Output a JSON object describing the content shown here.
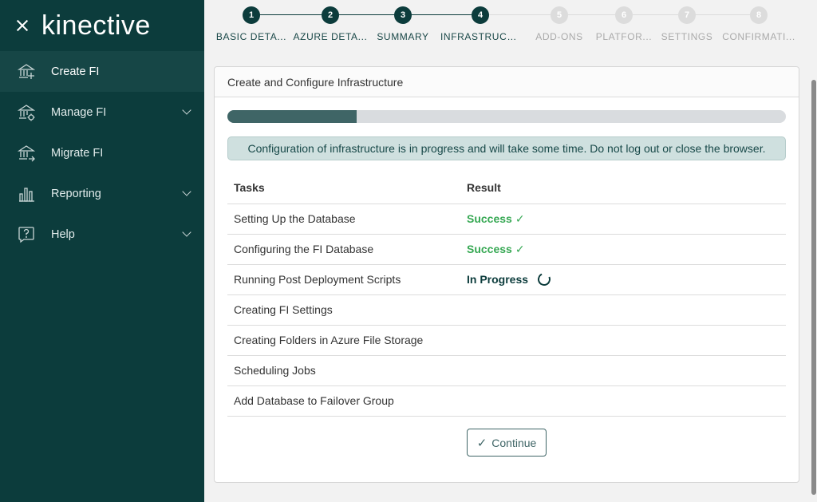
{
  "app": {
    "logo_text": "kinective"
  },
  "sidebar": {
    "items": [
      {
        "label": "Create FI",
        "icon": "bank-plus-icon",
        "active": true,
        "expandable": false
      },
      {
        "label": "Manage FI",
        "icon": "bank-gear-icon",
        "active": false,
        "expandable": true
      },
      {
        "label": "Migrate FI",
        "icon": "bank-arrow-icon",
        "active": false,
        "expandable": false
      },
      {
        "label": "Reporting",
        "icon": "bar-chart-icon",
        "active": false,
        "expandable": true
      },
      {
        "label": "Help",
        "icon": "help-bubble-icon",
        "active": false,
        "expandable": true
      }
    ]
  },
  "stepper": {
    "steps": [
      {
        "number": "1",
        "label": "BASIC DETA...",
        "state": "done"
      },
      {
        "number": "2",
        "label": "AZURE DETA...",
        "state": "done"
      },
      {
        "number": "3",
        "label": "SUMMARY",
        "state": "done"
      },
      {
        "number": "4",
        "label": "INFRASTRUCT...",
        "state": "done"
      },
      {
        "number": "5",
        "label": "ADD-ONS",
        "state": "todo"
      },
      {
        "number": "6",
        "label": "PLATFOR...",
        "state": "todo"
      },
      {
        "number": "7",
        "label": "SETTINGS",
        "state": "todo"
      },
      {
        "number": "8",
        "label": "CONFIRMATI...",
        "state": "todo"
      }
    ]
  },
  "card": {
    "title": "Create and Configure Infrastructure",
    "progress_fraction": 0.232,
    "alert": "Configuration of infrastructure is in progress and will take some time. Do not log out or close the browser.",
    "table": {
      "headers": {
        "tasks": "Tasks",
        "result": "Result"
      },
      "rows": [
        {
          "task": "Setting Up the Database",
          "result": "Success",
          "status": "success"
        },
        {
          "task": "Configuring the FI Database",
          "result": "Success",
          "status": "success"
        },
        {
          "task": "Running Post Deployment Scripts",
          "result": "In Progress",
          "status": "progress"
        },
        {
          "task": "Creating FI Settings",
          "result": "",
          "status": "none"
        },
        {
          "task": "Creating Folders in Azure File Storage",
          "result": "",
          "status": "none"
        },
        {
          "task": "Scheduling Jobs",
          "result": "",
          "status": "none"
        },
        {
          "task": "Add Database to Failover Group",
          "result": "",
          "status": "none"
        }
      ]
    },
    "continue_label": "Continue"
  },
  "colors": {
    "sidebar_bg": "#0c3c3c",
    "accent": "#3f6566",
    "success": "#36a853"
  }
}
